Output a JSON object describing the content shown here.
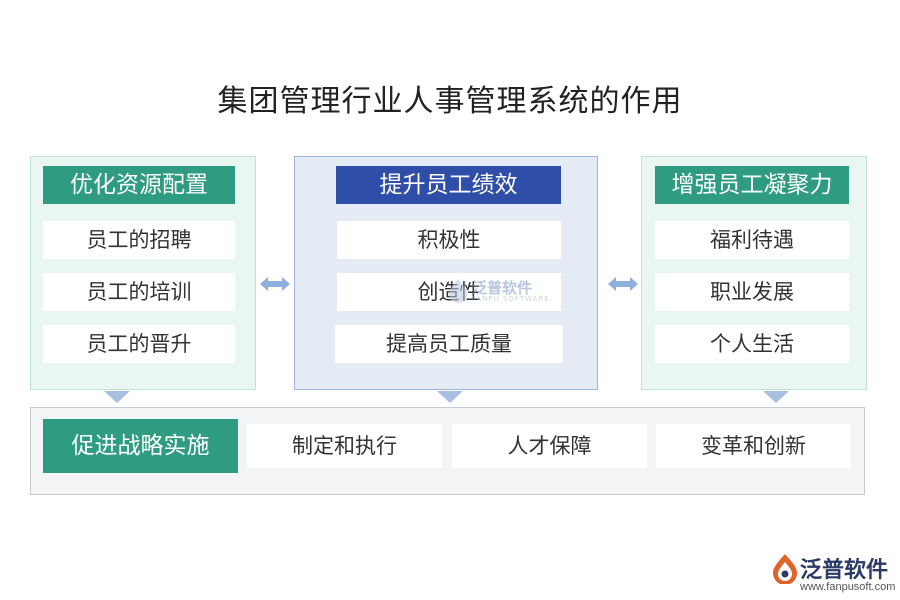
{
  "title": "集团管理行业人事管理系统的作用",
  "panels": {
    "left": {
      "header": "优化资源配置",
      "items": [
        "员工的招聘",
        "员工的培训",
        "员工的晋升"
      ]
    },
    "middle": {
      "header": "提升员工绩效",
      "items": [
        "积极性",
        "创造性",
        "提高员工质量"
      ]
    },
    "right": {
      "header": "增强员工凝聚力",
      "items": [
        "福利待遇",
        "职业发展",
        "个人生活"
      ]
    }
  },
  "bottom": {
    "header": "促进战略实施",
    "items": [
      "制定和执行",
      "人才保障",
      "变革和创新"
    ]
  },
  "watermark": {
    "text": "泛普软件",
    "sub": "FANPU SOFTWARE"
  },
  "logo": {
    "text": "泛普软件",
    "url": "www.fanpusoft.com"
  },
  "colors": {
    "green": "#2f9c82",
    "blue": "#2f4ea8",
    "arrow": "#8fb0dc"
  }
}
